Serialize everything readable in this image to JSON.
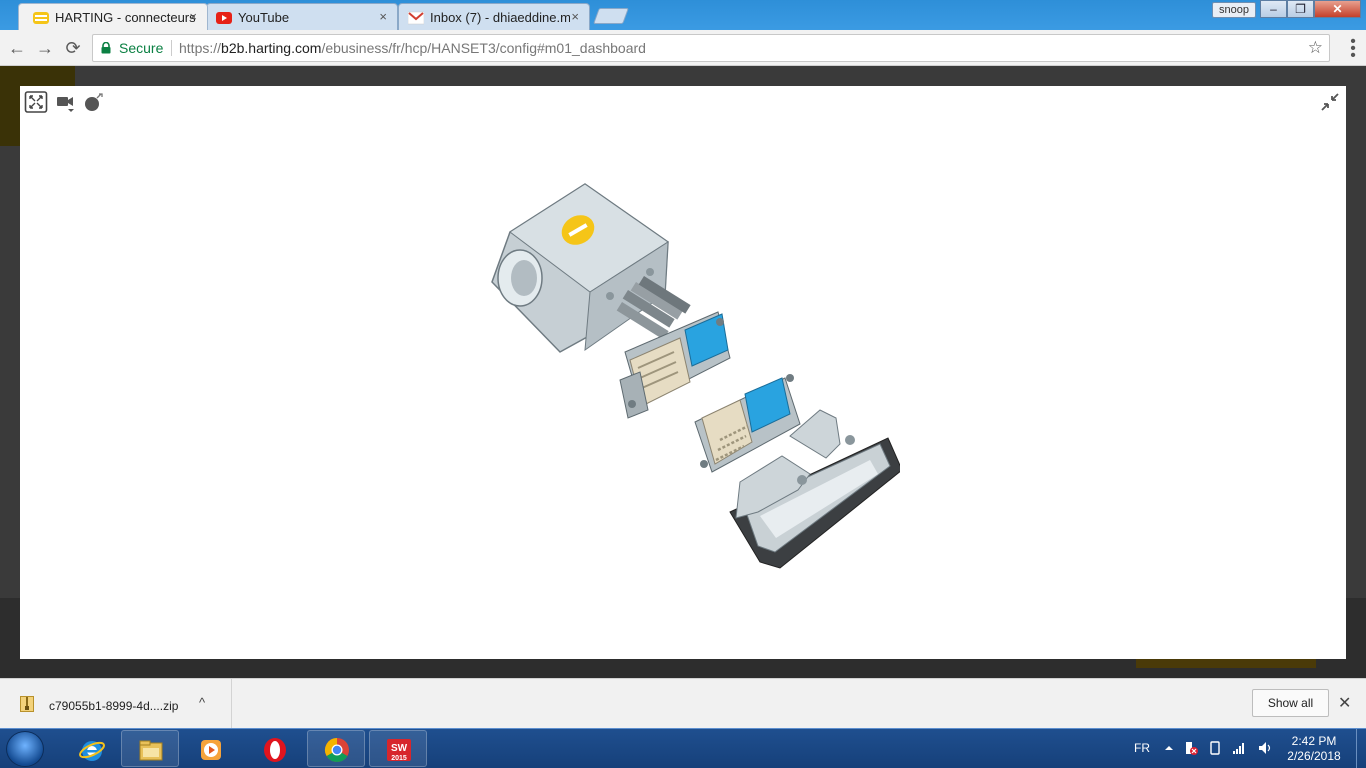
{
  "browser": {
    "tabs": [
      {
        "label": "HARTING - connecteurs",
        "active": true,
        "icon": "harting-icon"
      },
      {
        "label": "YouTube",
        "active": false,
        "icon": "youtube-icon"
      },
      {
        "label": "Inbox (7) - dhiaeddine.m",
        "active": false,
        "icon": "gmail-icon"
      }
    ],
    "tab_close": "×",
    "profile_label": "snoop",
    "window_buttons": {
      "minimize": "–",
      "maximize": "❐",
      "close": "✕"
    },
    "nav": {
      "back": "←",
      "forward": "→",
      "reload": "⟳"
    },
    "secure_label": "Secure",
    "url_scheme": "https://",
    "url_host": "b2b.harting.com",
    "url_path": "/ebusiness/fr/hcp/HANSET3/config#m01_dashboard",
    "star": "☆",
    "menu": "⋮"
  },
  "viewer": {
    "tools": [
      "fit-view-icon",
      "camera-icon",
      "explode-icon"
    ],
    "collapse_icon": "collapse-icon"
  },
  "downloads": {
    "file_name": "c79055b1-8999-4d....zip",
    "chevron": "^",
    "show_all_label": "Show all",
    "close": "✕"
  },
  "taskbar": {
    "apps": [
      "ie-icon",
      "explorer-icon",
      "media-player-icon",
      "opera-icon",
      "chrome-icon",
      "solidworks-icon"
    ],
    "solidworks_badge": "2015",
    "language": "FR",
    "time": "2:42 PM",
    "date": "2/26/2018"
  },
  "colors": {
    "chrome_blue": "#2e8fd8",
    "secure_green": "#0b8043",
    "taskbar_blue": "#1f4f8f",
    "harting_yellow": "#f5c518",
    "connector_grey": "#c5ced3",
    "insert_blue": "#29a3e0",
    "insert_beige": "#e6dcc3"
  }
}
